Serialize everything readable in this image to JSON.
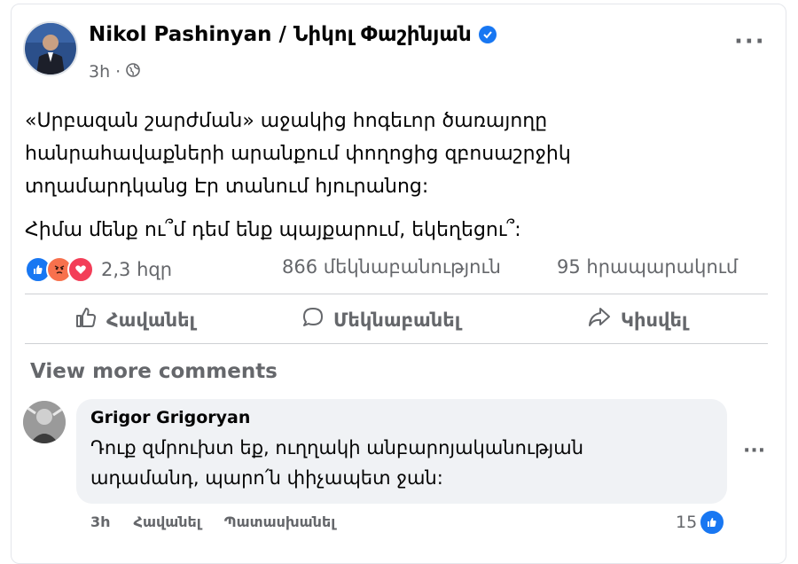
{
  "post": {
    "author": "Nikol Pashinyan / Նիկոլ Փաշինյան",
    "time": "3h",
    "body_line1": "«Սրբազան շարժման» աջակից հոգեւոր ծառայողը",
    "body_line2": "հանրահավաքների արանքում փողոցից զբոսաշրջիկ",
    "body_line3": "տղամարդկանց Էր տանում հյուրանոց:",
    "body_line4": "Հիմա մենք ու՞մ դեմ ենք պայքարում, եկեղեցու՞:",
    "reaction_count": "2,3 հզր",
    "comments_count": "866 մեկնաբանություն",
    "shares_count": "95 հրապարակում"
  },
  "actions": {
    "like": "Հավանել",
    "comment": "Մեկնաբանել",
    "share": "Կիսվել"
  },
  "comments": {
    "view_more": "View more comments",
    "items": [
      {
        "name": "Grigor Grigoryan",
        "text_line1": "Դուք զմրուխտ եք, ուղղակի անբարոյականության",
        "text_line2": "ադամանդ, պարո՛ն փիչապետ ջան:",
        "time": "3h",
        "like_label": "Հավանել",
        "reply_label": "Պատասխանել",
        "likes": "15"
      }
    ]
  },
  "colors": {
    "accent": "#1877f2",
    "muted_text": "#65676b",
    "comment_bg": "#f0f2f5",
    "love": "#f33e58",
    "angry": "#f7714d"
  },
  "icons": {
    "verified": "verified-badge-icon",
    "privacy": "globe-icon",
    "like": "thumbs-up-icon",
    "comment": "speech-bubble-icon",
    "share": "share-arrow-icon"
  }
}
